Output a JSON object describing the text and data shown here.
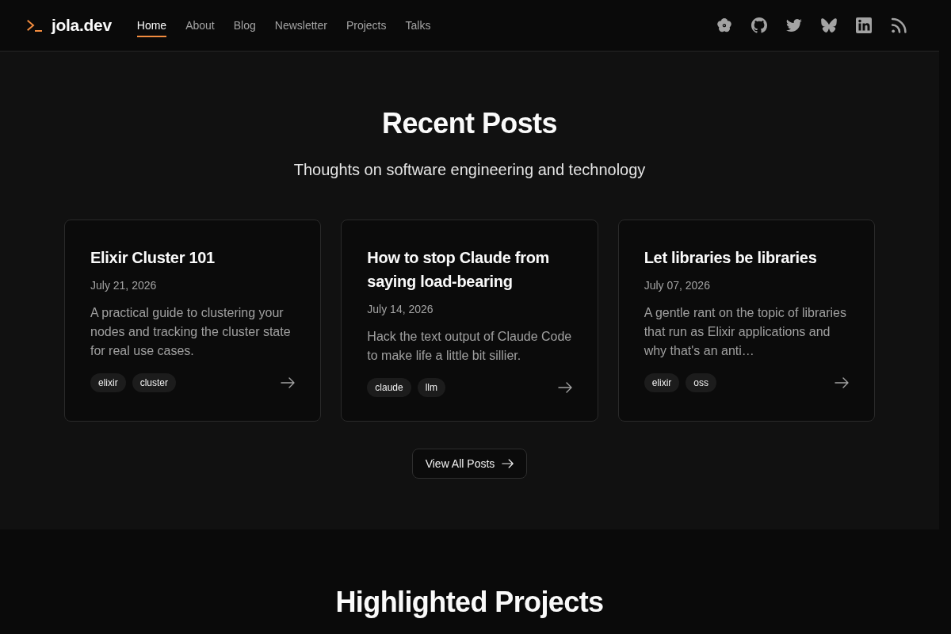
{
  "header": {
    "site_name": "jola.dev",
    "nav": [
      {
        "label": "Home",
        "selected": true
      },
      {
        "label": "About",
        "selected": false
      },
      {
        "label": "Blog",
        "selected": false
      },
      {
        "label": "Newsletter",
        "selected": false
      },
      {
        "label": "Projects",
        "selected": false
      },
      {
        "label": "Talks",
        "selected": false
      }
    ]
  },
  "recent_posts": {
    "title": "Recent Posts",
    "subtitle": "Thoughts on software engineering and technology",
    "posts": [
      {
        "title": "Elixir Cluster 101",
        "date": "July 21, 2026",
        "summary": "A practical guide to clustering your nodes and tracking the cluster state for real use cases.",
        "tags": [
          "elixir",
          "cluster"
        ]
      },
      {
        "title": "How to stop Claude from saying load-bearing",
        "date": "July 14, 2026",
        "summary": "Hack the text output of Claude Code to make life a little bit sillier.",
        "tags": [
          "claude",
          "llm"
        ]
      },
      {
        "title": "Let libraries be libraries",
        "date": "July 07, 2026",
        "summary": "A gentle rant on the topic of libraries that run as Elixir applications and why that's an anti…",
        "tags": [
          "elixir",
          "oss"
        ]
      }
    ],
    "view_all_button": "View All Posts"
  },
  "highlighted_projects": {
    "title": "Highlighted Projects"
  }
}
